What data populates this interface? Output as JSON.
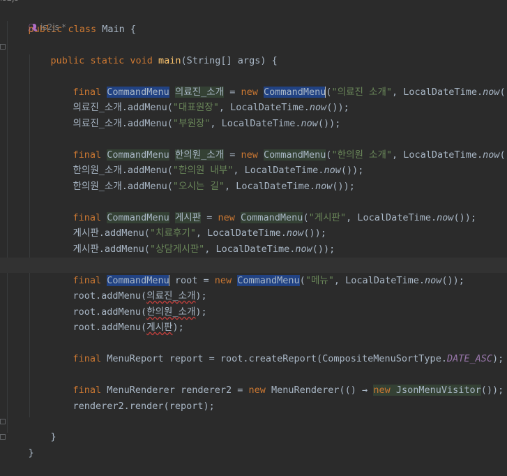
{
  "code": {
    "top_author": "is2js",
    "class_decl": {
      "kw1": "public",
      "kw2": "class",
      "name": "Main",
      "brace": "{"
    },
    "author": {
      "name": "is2js *"
    },
    "method_decl": {
      "kw1": "public",
      "kw2": "static",
      "kw3": "void",
      "name": "main",
      "params": "(String[] args) {"
    },
    "block1": {
      "l1": {
        "kw": "final",
        "type": "CommandMenu",
        "var": "의료진_소개",
        "eq": " = ",
        "new": "new",
        "type2": "CommandMenu",
        "arg": "\"의료진 소개\"",
        "rest1": ", LocalDateTime.",
        "now": "now",
        "rest2": "());"
      },
      "l2": {
        "obj": "의료진_소개.addMenu(",
        "arg": "\"대표원장\"",
        "rest1": ", LocalDateTime.",
        "now": "now",
        "rest2": "());"
      },
      "l3": {
        "obj": "의료진_소개.addMenu(",
        "arg": "\"부원장\"",
        "rest1": ", LocalDateTime.",
        "now": "now",
        "rest2": "());"
      }
    },
    "block2": {
      "l1": {
        "kw": "final",
        "type": "CommandMenu",
        "var": "한의원_소개",
        "eq": " = ",
        "new": "new",
        "type2": "CommandMenu",
        "arg": "\"한의원 소개\"",
        "rest1": ", LocalDateTime.",
        "now": "now",
        "rest2": "());"
      },
      "l2": {
        "obj": "한의원_소개.addMenu(",
        "arg": "\"한의원 내부\"",
        "rest1": ", LocalDateTime.",
        "now": "now",
        "rest2": "());"
      },
      "l3": {
        "obj": "한의원_소개.addMenu(",
        "arg": "\"오시는 길\"",
        "rest1": ", LocalDateTime.",
        "now": "now",
        "rest2": "());"
      }
    },
    "block3": {
      "l1": {
        "kw": "final",
        "type": "CommandMenu",
        "var": "게시판",
        "eq": " = ",
        "new": "new",
        "type2": "CommandMenu",
        "arg": "\"게시판\"",
        "rest1": ", LocalDateTime.",
        "now": "now",
        "rest2": "());"
      },
      "l2": {
        "obj": "게시판.addMenu(",
        "arg": "\"치료후기\"",
        "rest1": ", LocalDateTime.",
        "now": "now",
        "rest2": "());"
      },
      "l3": {
        "obj": "게시판.addMenu(",
        "arg": "\"상담게시판\"",
        "rest1": ", LocalDateTime.",
        "now": "now",
        "rest2": "());"
      }
    },
    "block4": {
      "l1": {
        "kw": "final",
        "type": "CommandMenu",
        "var": " root = ",
        "new": "new",
        "type2": "CommandMenu",
        "arg": "\"메뉴\"",
        "rest1": ", LocalDateTime.",
        "now": "now",
        "rest2": "());"
      },
      "l2": {
        "pre": "root.addMenu(",
        "arg": "의료진_소개",
        "post": ");"
      },
      "l3": {
        "pre": "root.addMenu(",
        "arg": "한의원_소개",
        "post": ");"
      },
      "l4": {
        "pre": "root.addMenu(",
        "arg": "게시판",
        "post": ");"
      }
    },
    "report": {
      "kw": "final",
      "rest1": " MenuReport report = root.createReport(CompositeMenuSortType.",
      "const": "DATE_ASC",
      "rest2": ");"
    },
    "renderer": {
      "kw": "final",
      "rest1": " MenuRenderer renderer2 = ",
      "new": "new",
      "rest2": " MenuRenderer(() ",
      "arrow": "→",
      "new2": "new",
      "rest3": " JsonMenuVisitor",
      "rest4": "());"
    },
    "render_call": "renderer2.render(report);",
    "close_method": "}",
    "close_class": "}"
  }
}
